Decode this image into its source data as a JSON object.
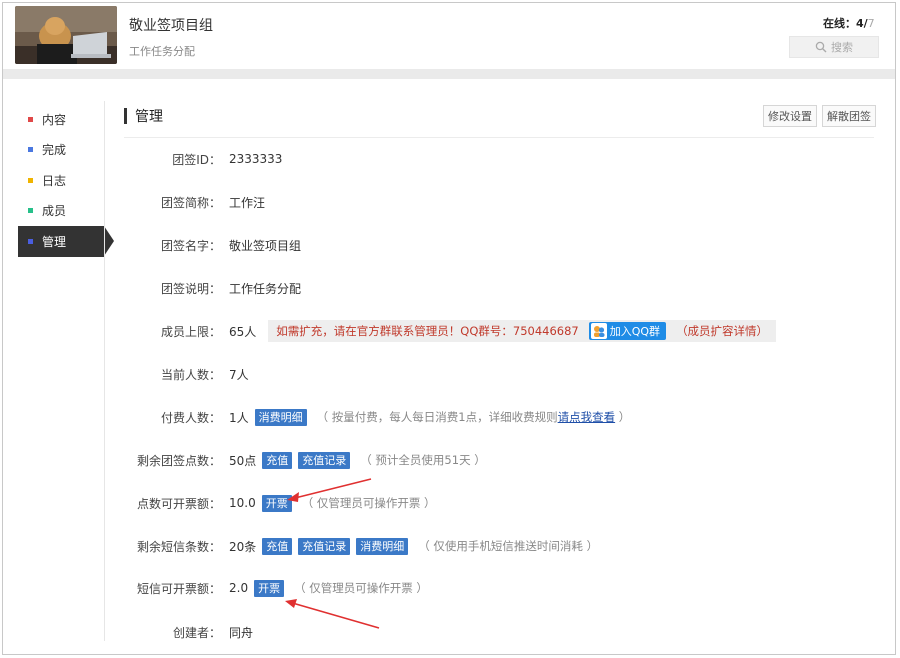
{
  "header": {
    "title": "敬业签项目组",
    "subtitle": "工作任务分配",
    "online_label": "在线：",
    "online_count": "4/",
    "online_total": "7",
    "search_label": "搜索"
  },
  "sidebar": {
    "items": [
      {
        "label": "内容",
        "color": "#e04848"
      },
      {
        "label": "完成",
        "color": "#4a78e0"
      },
      {
        "label": "日志",
        "color": "#f0b400"
      },
      {
        "label": "成员",
        "color": "#27c08a"
      },
      {
        "label": "管理",
        "color": "#4a5ee0"
      }
    ],
    "active_index": 4
  },
  "main": {
    "title": "管理",
    "edit_settings": "修改设置",
    "dissolve": "解散团签",
    "fields": {
      "id": {
        "label": "团签ID：",
        "value": "2333333"
      },
      "short_name": {
        "label": "团签简称：",
        "value": "工作汪"
      },
      "full_name": {
        "label": "团签名字：",
        "value": "敬业签项目组"
      },
      "desc": {
        "label": "团签说明：",
        "value": "工作任务分配"
      },
      "limit": {
        "label": "成员上限：",
        "value": "65人",
        "notice": "如需扩充，请在官方群联系管理员！QQ群号：750446687",
        "qq_button": "加入QQ群",
        "detail_link": "（成员扩容详情）"
      },
      "current": {
        "label": "当前人数：",
        "value": "7人"
      },
      "paid": {
        "label": "付费人数：",
        "value": "1人",
        "btn": "消费明细",
        "note_prefix": "（ 按量付费，每人每日消费1点，详细收费规则",
        "note_link": "请点我查看",
        "note_suffix": " ）"
      },
      "points": {
        "label": "剩余团签点数：",
        "value": "50点",
        "btn_recharge": "充值",
        "btn_record": "充值记录",
        "note": "（ 预计全员使用51天 ）"
      },
      "points_invoice": {
        "label": "点数可开票额：",
        "value": "10.0",
        "btn": "开票",
        "note": "（ 仅管理员可操作开票 ）"
      },
      "sms": {
        "label": "剩余短信条数：",
        "value": "20条",
        "btn_recharge": "充值",
        "btn_record": "充值记录",
        "btn_detail": "消费明细",
        "note": "（ 仅使用手机短信推送时间消耗 ）"
      },
      "sms_invoice": {
        "label": "短信可开票额：",
        "value": "2.0",
        "btn": "开票",
        "note": "（ 仅管理员可操作开票 ）"
      },
      "creator": {
        "label": "创建者：",
        "value": "同舟"
      }
    }
  }
}
